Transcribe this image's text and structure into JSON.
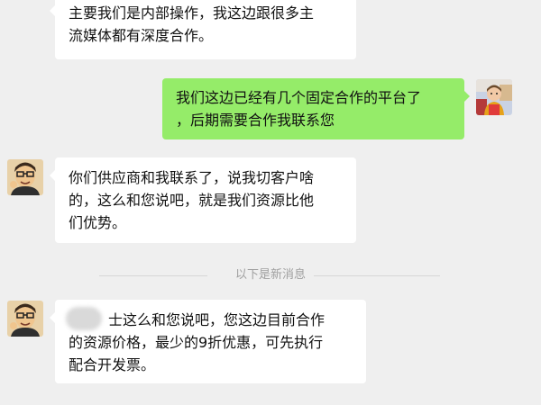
{
  "messages": [
    {
      "side": "left",
      "lines": [
        "主要我们是内部操作，我这边跟很多主",
        "流媒体都有深度合作。"
      ]
    },
    {
      "side": "right",
      "lines": [
        "我们这边已经有几个固定合作的平台了",
        "，后期需要合作我联系您"
      ]
    },
    {
      "side": "left",
      "lines": [
        "你们供应商和我联系了，说我切客户啥",
        "的，这么和您说吧，就是我们资源比他",
        "们优势。"
      ]
    },
    {
      "side": "left",
      "lines": [
        "士这么和您说吧，您这边目前合作",
        "的资源价格，最少的9折优惠，可先执行",
        "配合开发票。"
      ]
    }
  ],
  "divider": {
    "label": "以下是新消息"
  },
  "colors": {
    "background": "#efefef",
    "incoming_bubble": "#ffffff",
    "outgoing_bubble": "#95ec69",
    "divider_text": "#a0a0a0"
  },
  "icons": {
    "contact_avatar": "cartoon-man-avatar",
    "self_avatar": "child-photo-avatar"
  }
}
